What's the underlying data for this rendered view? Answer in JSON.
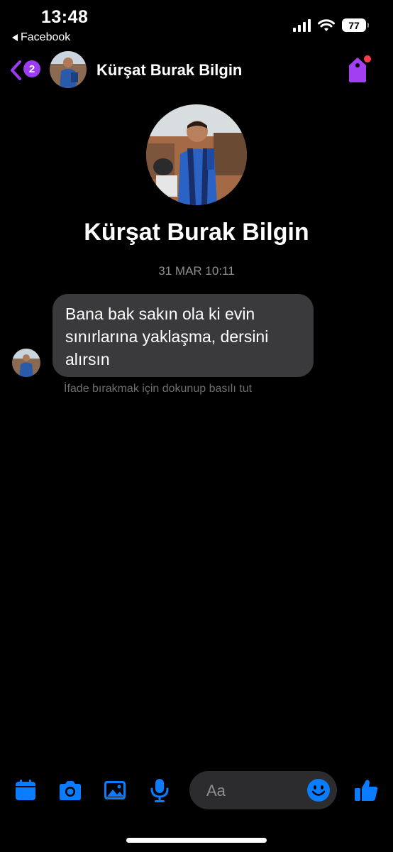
{
  "status_bar": {
    "time": "13:48",
    "back_app": "Facebook",
    "battery": "77"
  },
  "header": {
    "unread_count": "2",
    "contact_name": "Kürşat Burak Bilgin"
  },
  "profile": {
    "name": "Kürşat Burak Bilgin"
  },
  "conversation": {
    "timestamp": "31 MAR 10:11",
    "messages": [
      {
        "sender": "Kürşat Burak Bilgin",
        "text": "Bana bak sakın ola ki evin sınırlarına yaklaşma, dersini alırsın"
      }
    ],
    "reaction_hint": "İfade bırakmak için dokunup basılı tut"
  },
  "composer": {
    "placeholder": "Aa"
  },
  "colors": {
    "accent_blue": "#0a7cff",
    "accent_purple": "#9b3cf0",
    "bubble": "#3a3a3c",
    "notification_dot": "#ff3b4a"
  },
  "icons": [
    "back-chevron-icon",
    "tag-icon",
    "calendar-icon",
    "camera-icon",
    "gallery-icon",
    "microphone-icon",
    "emoji-icon",
    "thumbs-up-icon"
  ]
}
